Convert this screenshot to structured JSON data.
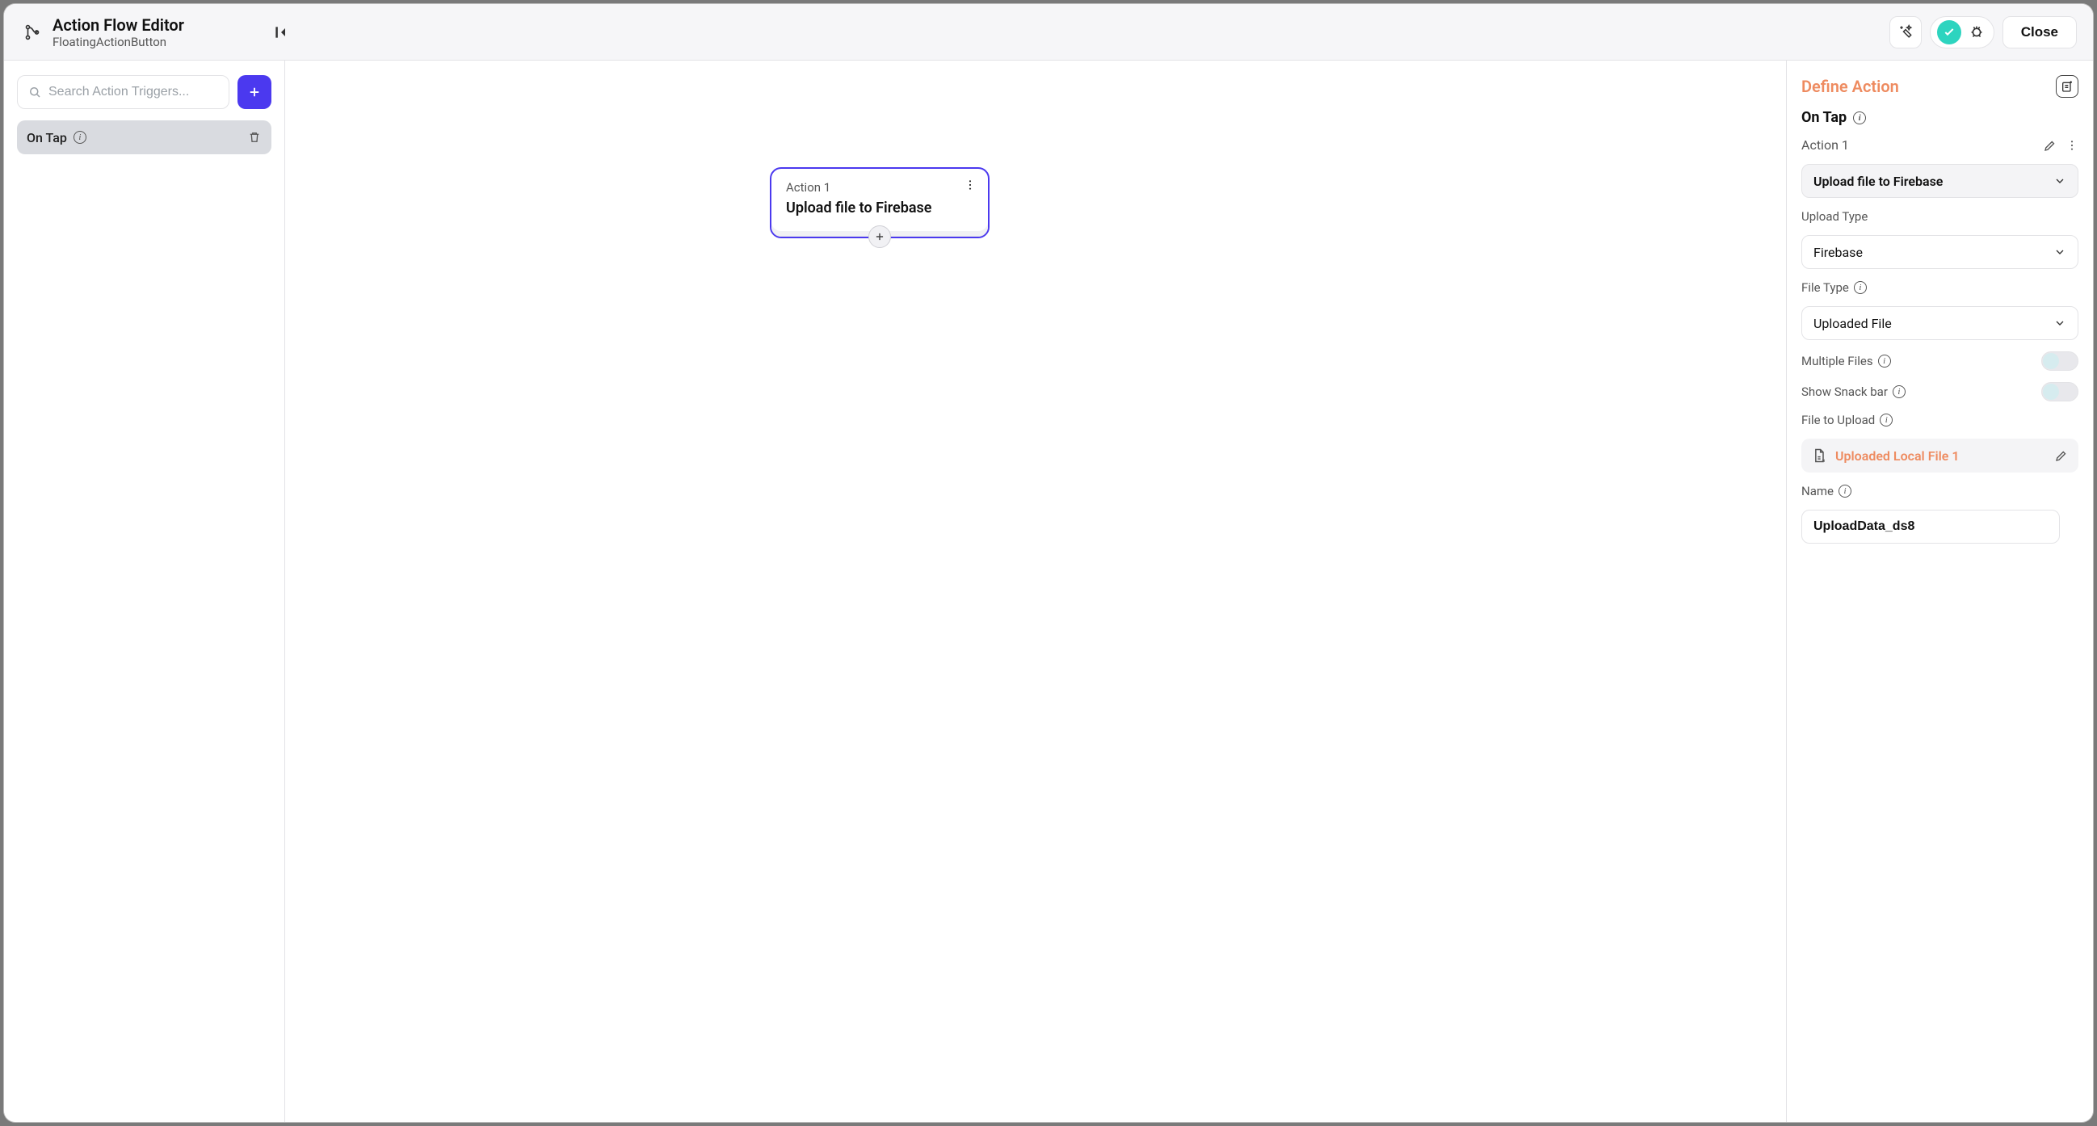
{
  "header": {
    "title": "Action Flow Editor",
    "subtitle": "FloatingActionButton",
    "close_label": "Close"
  },
  "left": {
    "search_placeholder": "Search Action Triggers...",
    "trigger_label": "On Tap"
  },
  "canvas": {
    "node_label": "Action 1",
    "node_title": "Upload file to Firebase"
  },
  "right": {
    "panel_title": "Define Action",
    "trigger_name": "On Tap",
    "action_label": "Action 1",
    "action_type": "Upload file to Firebase",
    "upload_type_label": "Upload Type",
    "upload_type_value": "Firebase",
    "file_type_label": "File Type",
    "file_type_value": "Uploaded File",
    "multiple_files_label": "Multiple Files",
    "show_snackbar_label": "Show Snack bar",
    "file_to_upload_label": "File to Upload",
    "file_chip_value": "Uploaded Local File 1",
    "name_label": "Name",
    "name_value": "UploadData_ds8"
  }
}
